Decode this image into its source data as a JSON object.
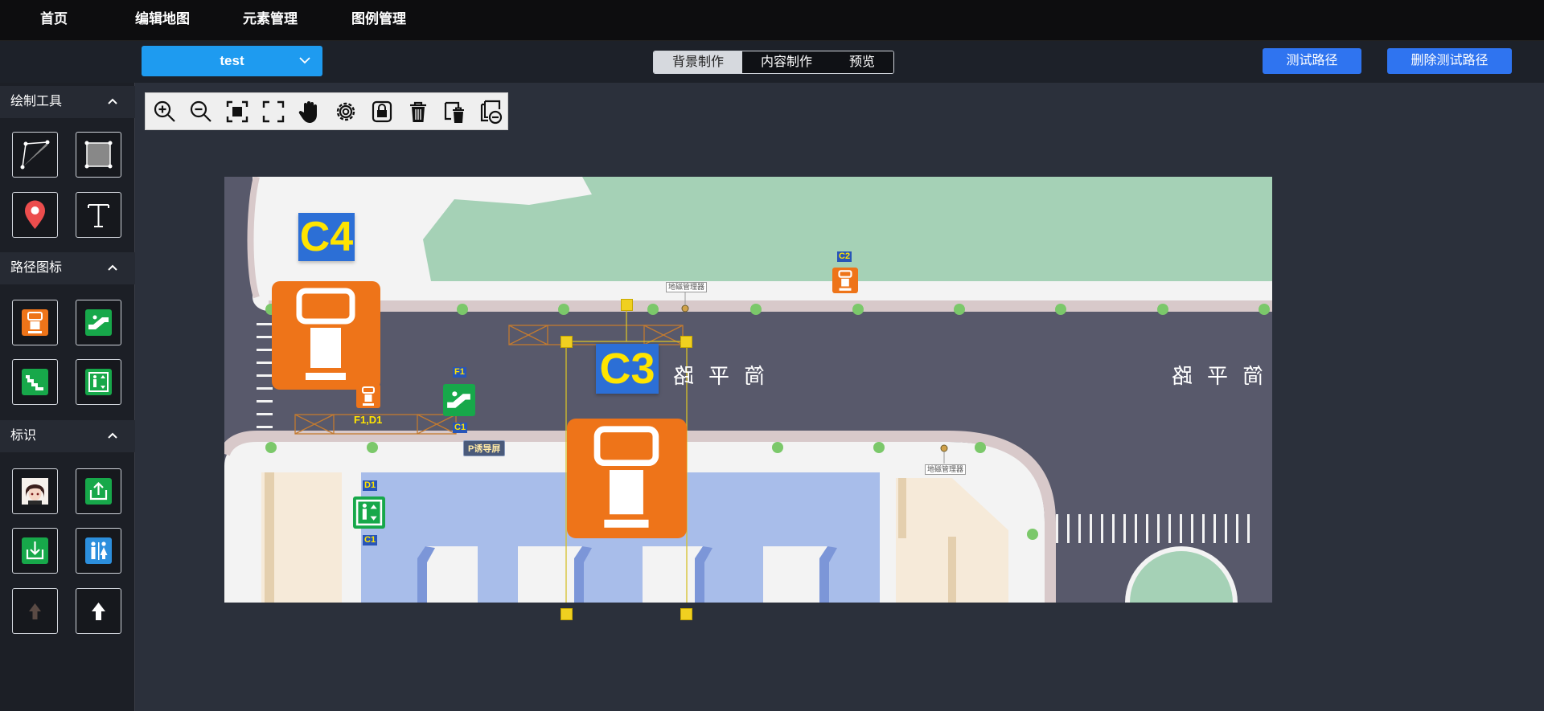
{
  "nav": {
    "items": [
      "首页",
      "编辑地图",
      "元素管理",
      "图例管理"
    ]
  },
  "subbar": {
    "map_name": "test",
    "modes": [
      "背景制作",
      "内容制作",
      "预览"
    ],
    "active_mode": "背景制作",
    "test_path_label": "测试路径",
    "delete_test_path_label": "删除测试路径"
  },
  "panel": {
    "draw_tools_title": "绘制工具",
    "path_icons_title": "路径图标",
    "markers_title": "标识"
  },
  "toolbar": {
    "icons": [
      "zoom-in-icon",
      "zoom-out-icon",
      "fit-screen-icon",
      "fullscreen-icon",
      "pan-hand-icon",
      "settings-gear-icon",
      "lock-icon",
      "delete-icon",
      "delete-layer-icon",
      "remove-layer-icon"
    ]
  },
  "map": {
    "label_c4": "C4",
    "label_c3": "C3",
    "label_c2": "C2",
    "label_f1": "F1",
    "label_c1_a": "C1",
    "label_f1d1": "F1,D1",
    "label_d1": "D1",
    "label_c1_b": "C1",
    "road_text_1": "简平路",
    "road_text_2": "简平路",
    "sign_1": "地磁管理器",
    "sign_2": "地磁管理器",
    "guide_sign": "P诱导屏",
    "colors": {
      "orange": "#ee7419",
      "green": "#17a84a",
      "blue_label": "#2c6fd6",
      "yellow": "#ffe400",
      "road": "#58596b",
      "lawn": "#a5d1b6",
      "parking": "#a8bdea"
    }
  }
}
